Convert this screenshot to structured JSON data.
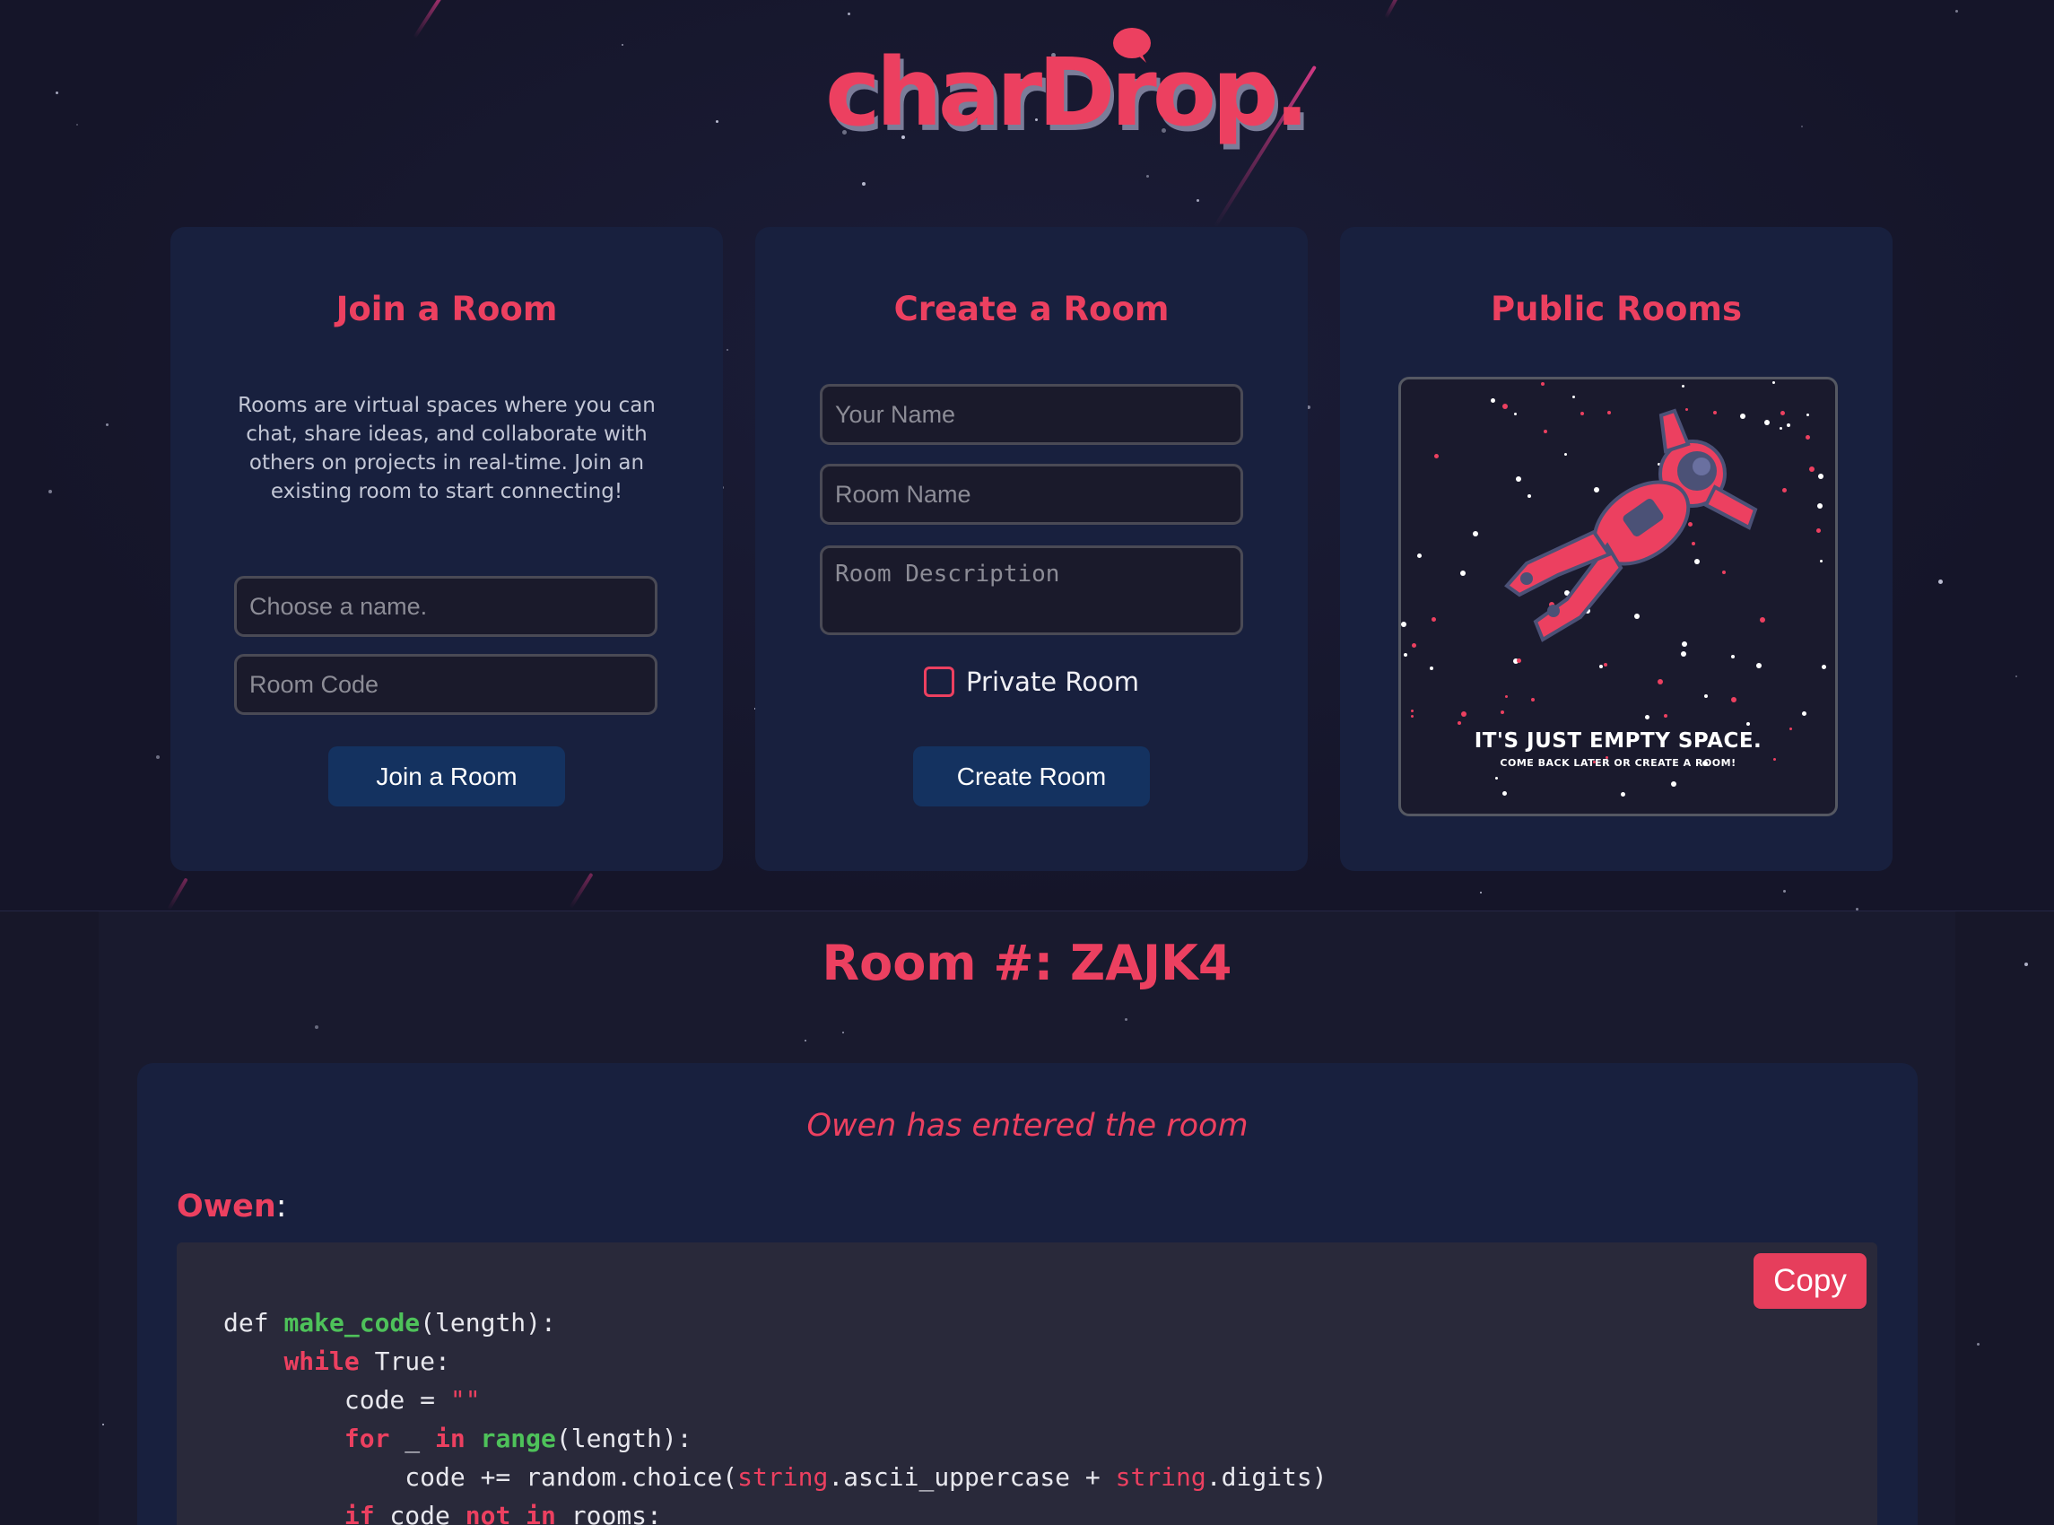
{
  "app": {
    "logo": "charDrop.",
    "accent": "#ec4060",
    "button_color": "#143260"
  },
  "join": {
    "title": "Join a Room",
    "description": "Rooms are virtual spaces where you can chat, share ideas, and collaborate with others on projects in real-time. Join an existing room to start connecting!",
    "name_placeholder": "Choose a name.",
    "code_placeholder": "Room Code",
    "button": "Join a Room"
  },
  "create": {
    "title": "Create a Room",
    "name_placeholder": "Your Name",
    "room_placeholder": "Room Name",
    "desc_placeholder": "Room Description",
    "private_label": "Private Room",
    "private_checked": false,
    "button": "Create Room"
  },
  "public": {
    "title": "Public Rooms",
    "empty_title": "IT'S JUST EMPTY SPACE.",
    "empty_sub": "COME BACK LATER OR CREATE A ROOM!"
  },
  "room": {
    "title": "Room #: ZAJK4",
    "system_message": "Owen has entered the room",
    "author": "Owen",
    "author_suffix": ":",
    "copy_button": "Copy",
    "code_lines": [
      [
        {
          "t": "def "
        },
        {
          "t": "make_code",
          "c": "fn"
        },
        {
          "t": "(length):"
        }
      ],
      [
        {
          "t": "    "
        },
        {
          "t": "while",
          "c": "kw"
        },
        {
          "t": " True:"
        }
      ],
      [
        {
          "t": "        code = "
        },
        {
          "t": "\"\"",
          "c": "str"
        }
      ],
      [
        {
          "t": "        "
        },
        {
          "t": "for",
          "c": "kw"
        },
        {
          "t": " _ "
        },
        {
          "t": "in",
          "c": "kw"
        },
        {
          "t": " "
        },
        {
          "t": "range",
          "c": "fn"
        },
        {
          "t": "(length):"
        }
      ],
      [
        {
          "t": "            code += random.choice("
        },
        {
          "t": "string",
          "c": "str"
        },
        {
          "t": ".ascii_uppercase + "
        },
        {
          "t": "string",
          "c": "str"
        },
        {
          "t": ".digits)"
        }
      ],
      [
        {
          "t": "        "
        },
        {
          "t": "if",
          "c": "kw"
        },
        {
          "t": " code "
        },
        {
          "t": "not in",
          "c": "kw"
        },
        {
          "t": " rooms:"
        }
      ]
    ]
  }
}
